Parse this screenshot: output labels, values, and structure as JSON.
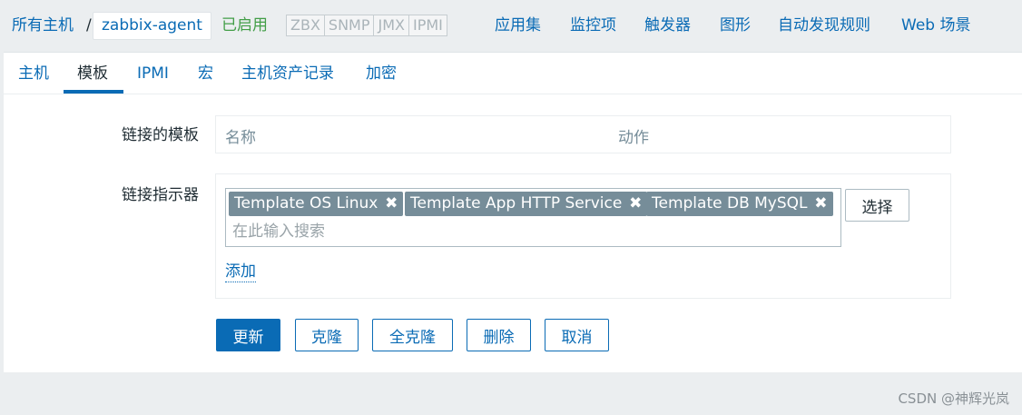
{
  "header": {
    "breadcrumb_all": "所有主机",
    "breadcrumb_sep": "/",
    "host_name": "zabbix-agent",
    "status": "已启用",
    "availability": [
      "ZBX",
      "SNMP",
      "JMX",
      "IPMI"
    ],
    "nav": {
      "applications": "应用集",
      "items": "监控项",
      "triggers": "触发器",
      "graphs": "图形",
      "discovery": "自动发现规则",
      "web": "Web 场景"
    }
  },
  "tabs": {
    "host": "主机",
    "templates": "模板",
    "ipmi": "IPMI",
    "macros": "宏",
    "inventory": "主机资产记录",
    "encryption": "加密"
  },
  "form": {
    "linked_templates_label": "链接的模板",
    "table_headers": {
      "name": "名称",
      "action": "动作"
    },
    "link_new_label": "链接指示器",
    "chips": [
      {
        "label": "Template OS Linux"
      },
      {
        "label": "Template App HTTP Service"
      },
      {
        "label": "Template DB MySQL"
      }
    ],
    "chip_remove_glyph": "✖",
    "search_placeholder": "在此输入搜索",
    "select_button": "选择",
    "add_link": "添加"
  },
  "buttons": {
    "update": "更新",
    "clone": "克隆",
    "full_clone": "全克隆",
    "delete": "删除",
    "cancel": "取消"
  },
  "watermark": "CSDN @神辉光岚",
  "colors": {
    "link": "#0a6bb5",
    "enabled": "#429e47",
    "chip": "#768d99",
    "page_bg": "#ebeef0"
  }
}
